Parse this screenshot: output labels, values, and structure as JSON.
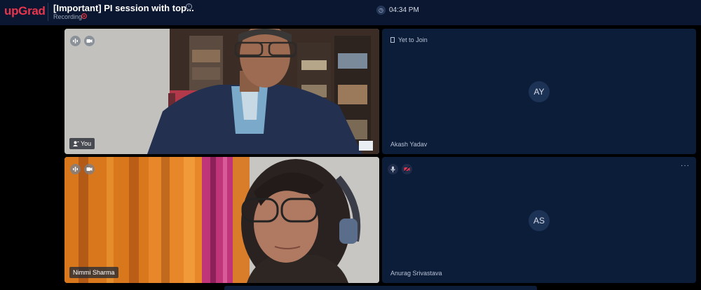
{
  "header": {
    "brand": "upGrad",
    "title": "[Important] PI session with top...",
    "status": "Recording",
    "time": "04:34 PM"
  },
  "tiles": [
    {
      "label": "You",
      "video": true
    },
    {
      "label": "Akash Yadav",
      "status": "Yet to Join",
      "initials": "AY",
      "video": false
    },
    {
      "label": "Nimmi Sharma",
      "video": true
    },
    {
      "label": "Anurag Srivastava",
      "initials": "AS",
      "video": false,
      "more": "···"
    }
  ],
  "colors": {
    "brand": "#e8364f",
    "background": "#0b1730",
    "tile": "#0c1d3a"
  },
  "icons": [
    "info-icon",
    "recording-icon",
    "clock-icon",
    "audio-icon",
    "video-icon",
    "mic-icon",
    "video-off-icon",
    "more-icon",
    "user-icon",
    "door-icon"
  ]
}
